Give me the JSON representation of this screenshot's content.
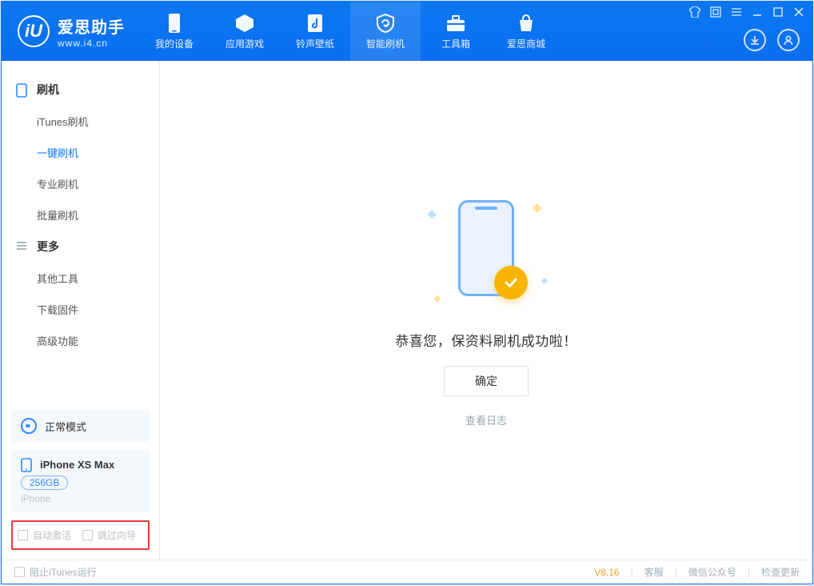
{
  "brand": {
    "cn": "爱思助手",
    "url": "www.i4.cn",
    "logo_letter": "iU"
  },
  "win_controls": {
    "shirt": "shirt",
    "box": "box",
    "menu": "menu",
    "min": "min",
    "max": "max",
    "close": "close"
  },
  "header": {
    "tabs": [
      {
        "label": "我的设备",
        "icon": "phone"
      },
      {
        "label": "应用游戏",
        "icon": "cube"
      },
      {
        "label": "铃声壁纸",
        "icon": "music"
      },
      {
        "label": "智能刷机",
        "icon": "refresh",
        "active": true
      },
      {
        "label": "工具箱",
        "icon": "toolbox"
      },
      {
        "label": "爱思商城",
        "icon": "bag"
      }
    ],
    "download_icon": "download",
    "user_icon": "user"
  },
  "sidebar": {
    "group1": {
      "title": "刷机",
      "items": [
        "iTunes刷机",
        "一键刷机",
        "专业刷机",
        "批量刷机"
      ],
      "active_index": 1
    },
    "group2": {
      "title": "更多",
      "items": [
        "其他工具",
        "下载固件",
        "高级功能"
      ]
    },
    "status": {
      "text": "正常模式"
    },
    "device": {
      "name": "iPhone XS Max",
      "capacity": "256GB",
      "type": "iPhone"
    },
    "options": {
      "auto_activate": "自动激活",
      "skip_guide": "跳过向导"
    }
  },
  "main": {
    "success_msg": "恭喜您，保资料刷机成功啦！",
    "confirm_btn": "确定",
    "view_log": "查看日志"
  },
  "footer": {
    "block_itunes": "阻止iTunes运行",
    "version": "V8.16",
    "links": [
      "客服",
      "微信公众号",
      "检查更新"
    ]
  }
}
